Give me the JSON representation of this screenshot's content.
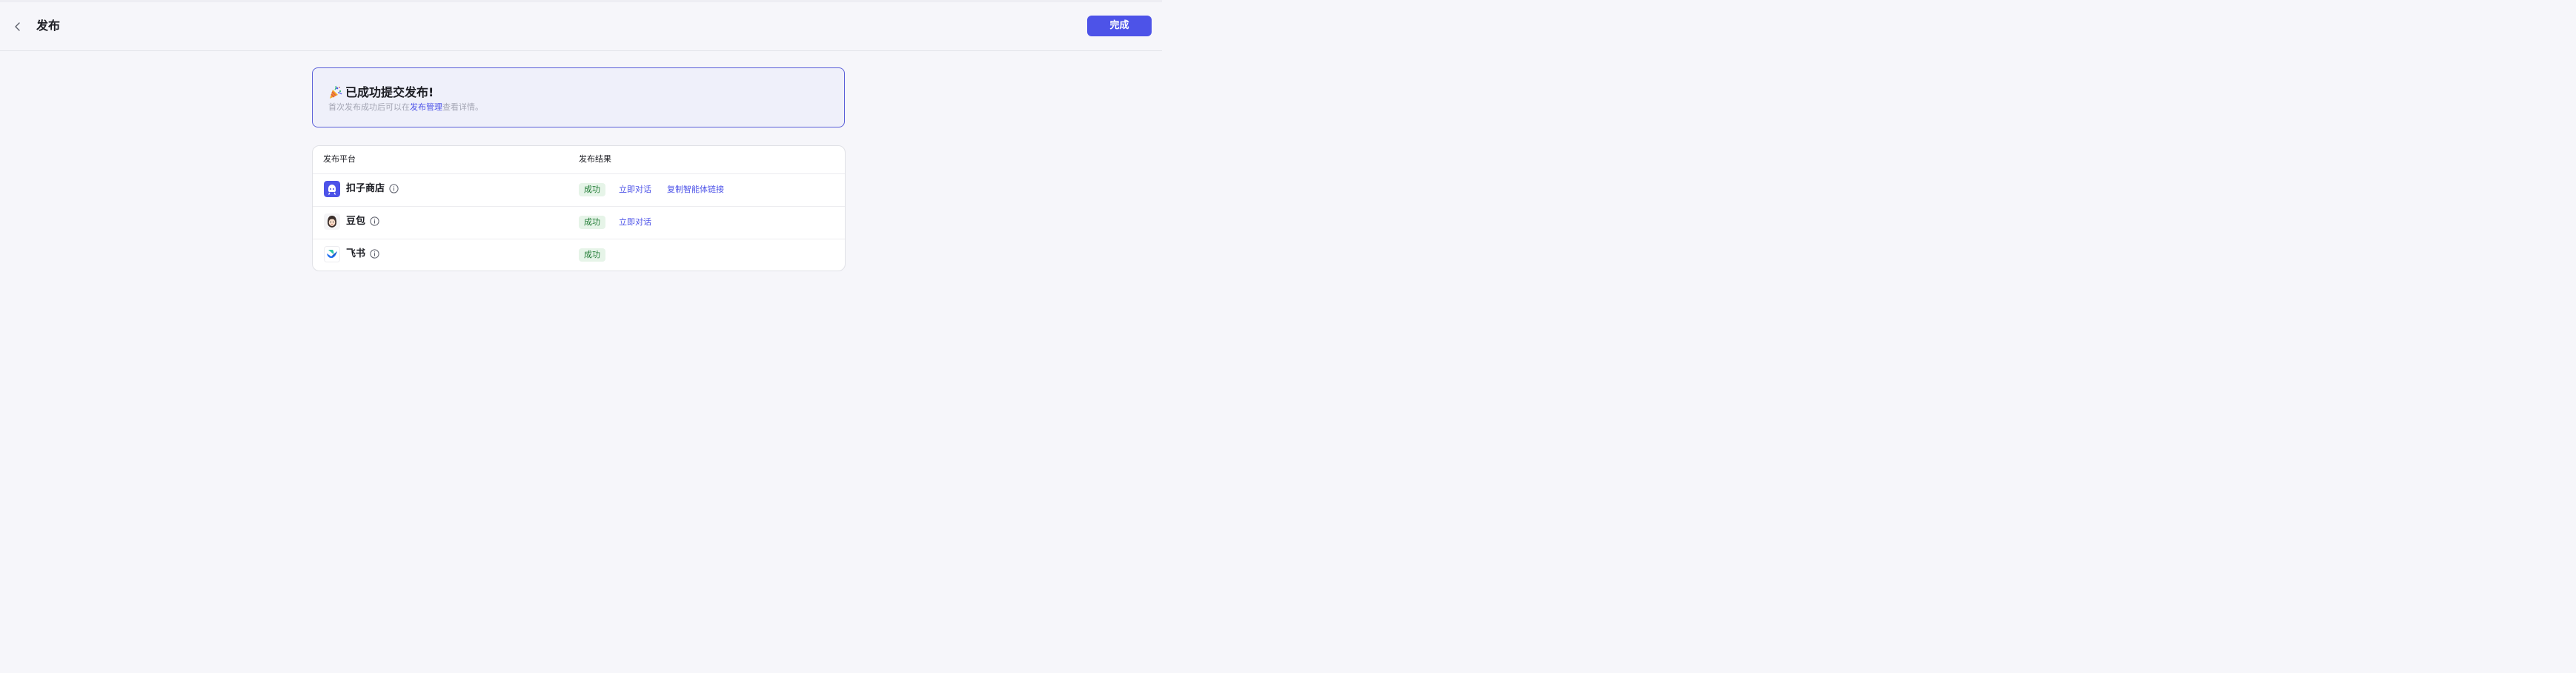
{
  "header": {
    "title": "发布",
    "done_label": "完成"
  },
  "banner": {
    "title": "已成功提交发布!",
    "subtitle_prefix": "首次发布成功后可以在",
    "subtitle_link": "发布管理",
    "subtitle_suffix": "查看详情。"
  },
  "table": {
    "columns": [
      "发布平台",
      "发布结果"
    ],
    "rows": [
      {
        "platform": "扣子商店",
        "icon": "coze-store-icon",
        "status": "成功",
        "actions": [
          "立即对话",
          "复制智能体链接"
        ]
      },
      {
        "platform": "豆包",
        "icon": "doubao-icon",
        "status": "成功",
        "actions": [
          "立即对话"
        ]
      },
      {
        "platform": "飞书",
        "icon": "feishu-icon",
        "status": "成功",
        "actions": []
      }
    ]
  },
  "colors": {
    "accent": "#4d53e8",
    "success_bg": "#e6f4e8",
    "success_text": "#1f7a33"
  }
}
